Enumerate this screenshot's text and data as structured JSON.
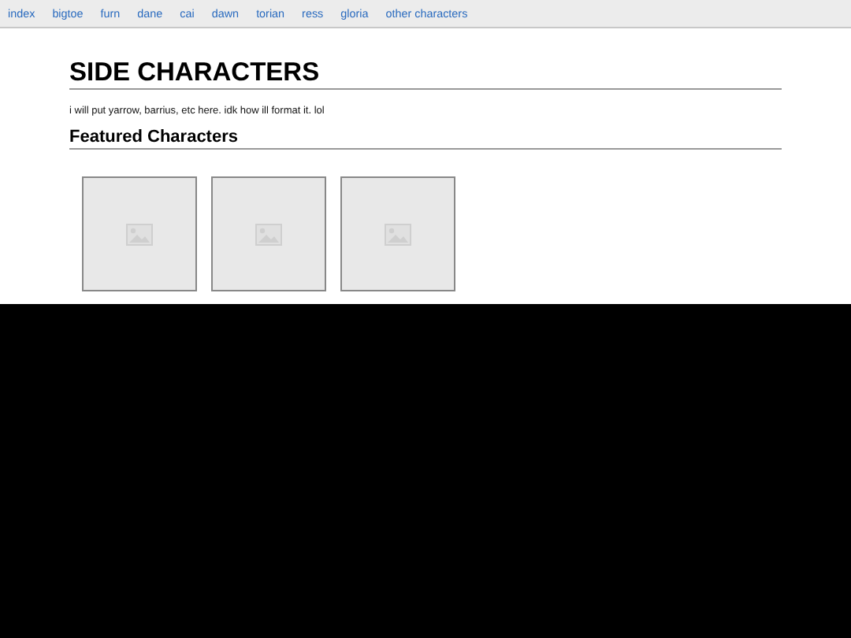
{
  "nav": {
    "links": [
      {
        "label": "index"
      },
      {
        "label": "bigtoe"
      },
      {
        "label": "furn"
      },
      {
        "label": "dane"
      },
      {
        "label": "cai"
      },
      {
        "label": "dawn"
      },
      {
        "label": "torian"
      },
      {
        "label": "ress"
      },
      {
        "label": "gloria"
      },
      {
        "label": "other characters"
      }
    ]
  },
  "page": {
    "title": "SIDE CHARACTERS",
    "intro": "i will put yarrow, barrius, etc here. idk how ill format it. lol",
    "section": "Featured Characters",
    "featured": [
      {
        "kind": "image_placeholder"
      },
      {
        "kind": "image_placeholder"
      },
      {
        "kind": "image_placeholder"
      }
    ]
  }
}
